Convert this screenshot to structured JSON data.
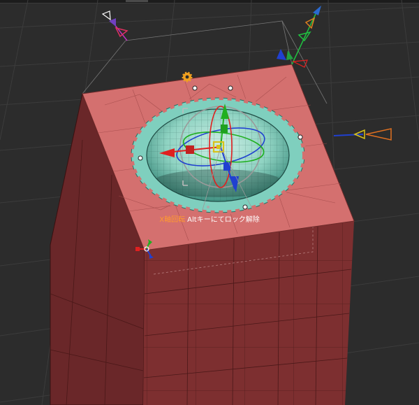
{
  "status_hint": {
    "axis_label": "X軸回転",
    "message": "Altキーにてロック解除"
  },
  "icons": {
    "pivot": "gear-icon",
    "camera": "camera-icon",
    "light": "light-icon",
    "origin_axes": "axis-gizmo-icon"
  },
  "colors": {
    "background": "#2c2c2c",
    "mesh_top": "#d4706f",
    "mesh_side_front": "#7d2f30",
    "mesh_side_left": "#6a2729",
    "hole_mesh": "#6bc6b4",
    "axis_x": "#e02020",
    "axis_y": "#20b020",
    "axis_z": "#2040d0",
    "hint_accent": "#ff9a2e"
  }
}
